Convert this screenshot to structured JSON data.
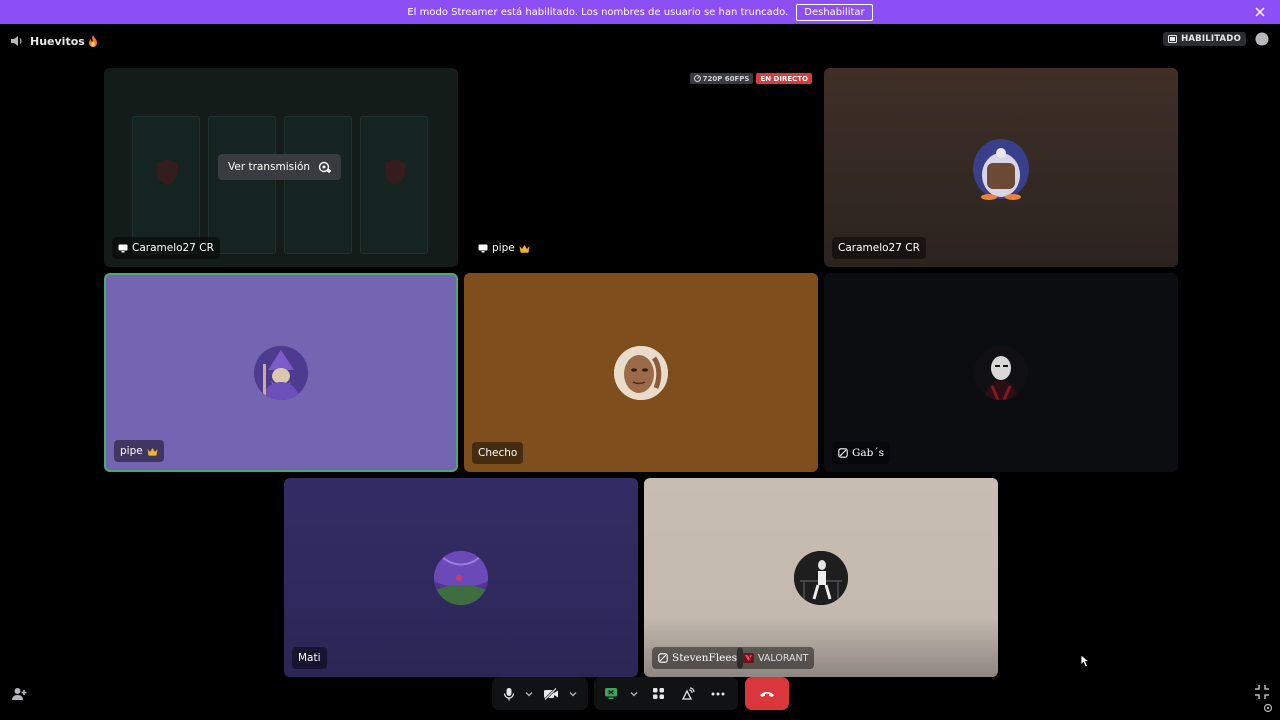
{
  "banner": {
    "message": "El modo Streamer está habilitado. Los nombres de usuario se han truncado.",
    "button_label": "Deshabilitar"
  },
  "header": {
    "channel_name": "Huevitos",
    "streamer_badge": "HABILITADO"
  },
  "stream_badges": {
    "quality": "720P 60FPS",
    "live": "EN DIRECTO"
  },
  "tiles": {
    "caramelo_share": {
      "name": "Caramelo27 CR",
      "button": "Ver transmisión"
    },
    "pipe_share": {
      "name": "pipe"
    },
    "caramelo_cam": {
      "name": "Caramelo27 CR"
    },
    "pipe": {
      "name": "pipe"
    },
    "checho": {
      "name": "Checho"
    },
    "gabs": {
      "name": "Gab´s"
    },
    "mati": {
      "name": "Mati"
    },
    "steven": {
      "name": "StevenFlees",
      "game": "VALORANT"
    }
  },
  "colors": {
    "accent": "#8c4ff5",
    "end_call": "#da373c",
    "speaking": "#4ea86f",
    "pipe_tile": "#7465b3",
    "checho_tile": "#7e4f1c",
    "mati_tile": "#332d66",
    "steven_tile": "#c7bdb3",
    "caramelo_tile": "#3f2f27",
    "gabs_tile": "#0c0d10"
  },
  "icons": {
    "banner_close": "close-icon",
    "volume": "volume-icon",
    "chat": "chat-icon",
    "mic": "microphone-icon",
    "camera": "camera-off-icon",
    "screen": "screen-share-icon",
    "activities": "activities-icon",
    "soundboard": "soundboard-icon",
    "more": "more-icon",
    "hangup": "hang-up-icon"
  }
}
